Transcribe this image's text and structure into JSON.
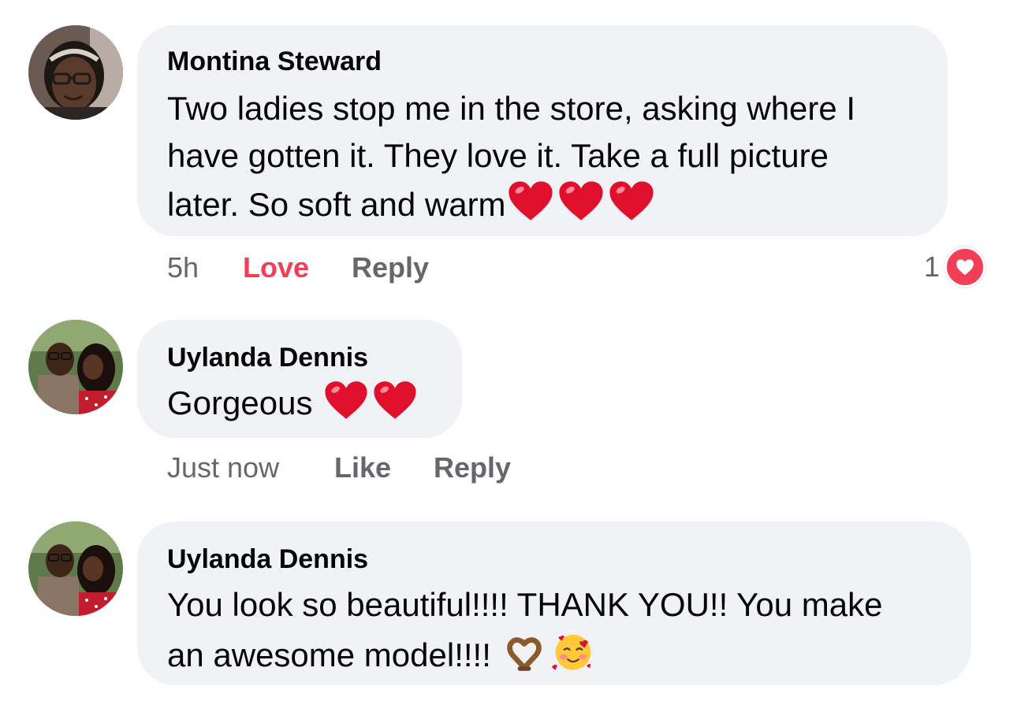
{
  "comments": [
    {
      "author": "Montina Steward",
      "lines": [
        "Two ladies stop me in the store, asking where I",
        "have gotten it. They love it. Take a full picture",
        "later. So soft and warm"
      ],
      "emoji": [
        "red-heart",
        "red-heart",
        "red-heart"
      ],
      "time": "5h",
      "reaction_label": "Love",
      "reply_label": "Reply",
      "reaction_count": "1",
      "reaction_type": "love-icon"
    },
    {
      "author": "Uylanda Dennis",
      "lines": [
        "Gorgeous"
      ],
      "emoji": [
        "red-heart",
        "red-heart"
      ],
      "time": "Just now",
      "reaction_label": "Like",
      "reply_label": "Reply"
    },
    {
      "author": "Uylanda Dennis",
      "lines": [
        "You look so beautiful!!!! THANK YOU!! You make",
        "an awesome model!!!!"
      ],
      "emoji": [
        "heart-hands",
        "smiling-face-with-hearts"
      ]
    }
  ],
  "colors": {
    "bubble": "#f0f2f5",
    "meta_text": "#65676b",
    "love": "#f33e58",
    "text": "#050505"
  }
}
